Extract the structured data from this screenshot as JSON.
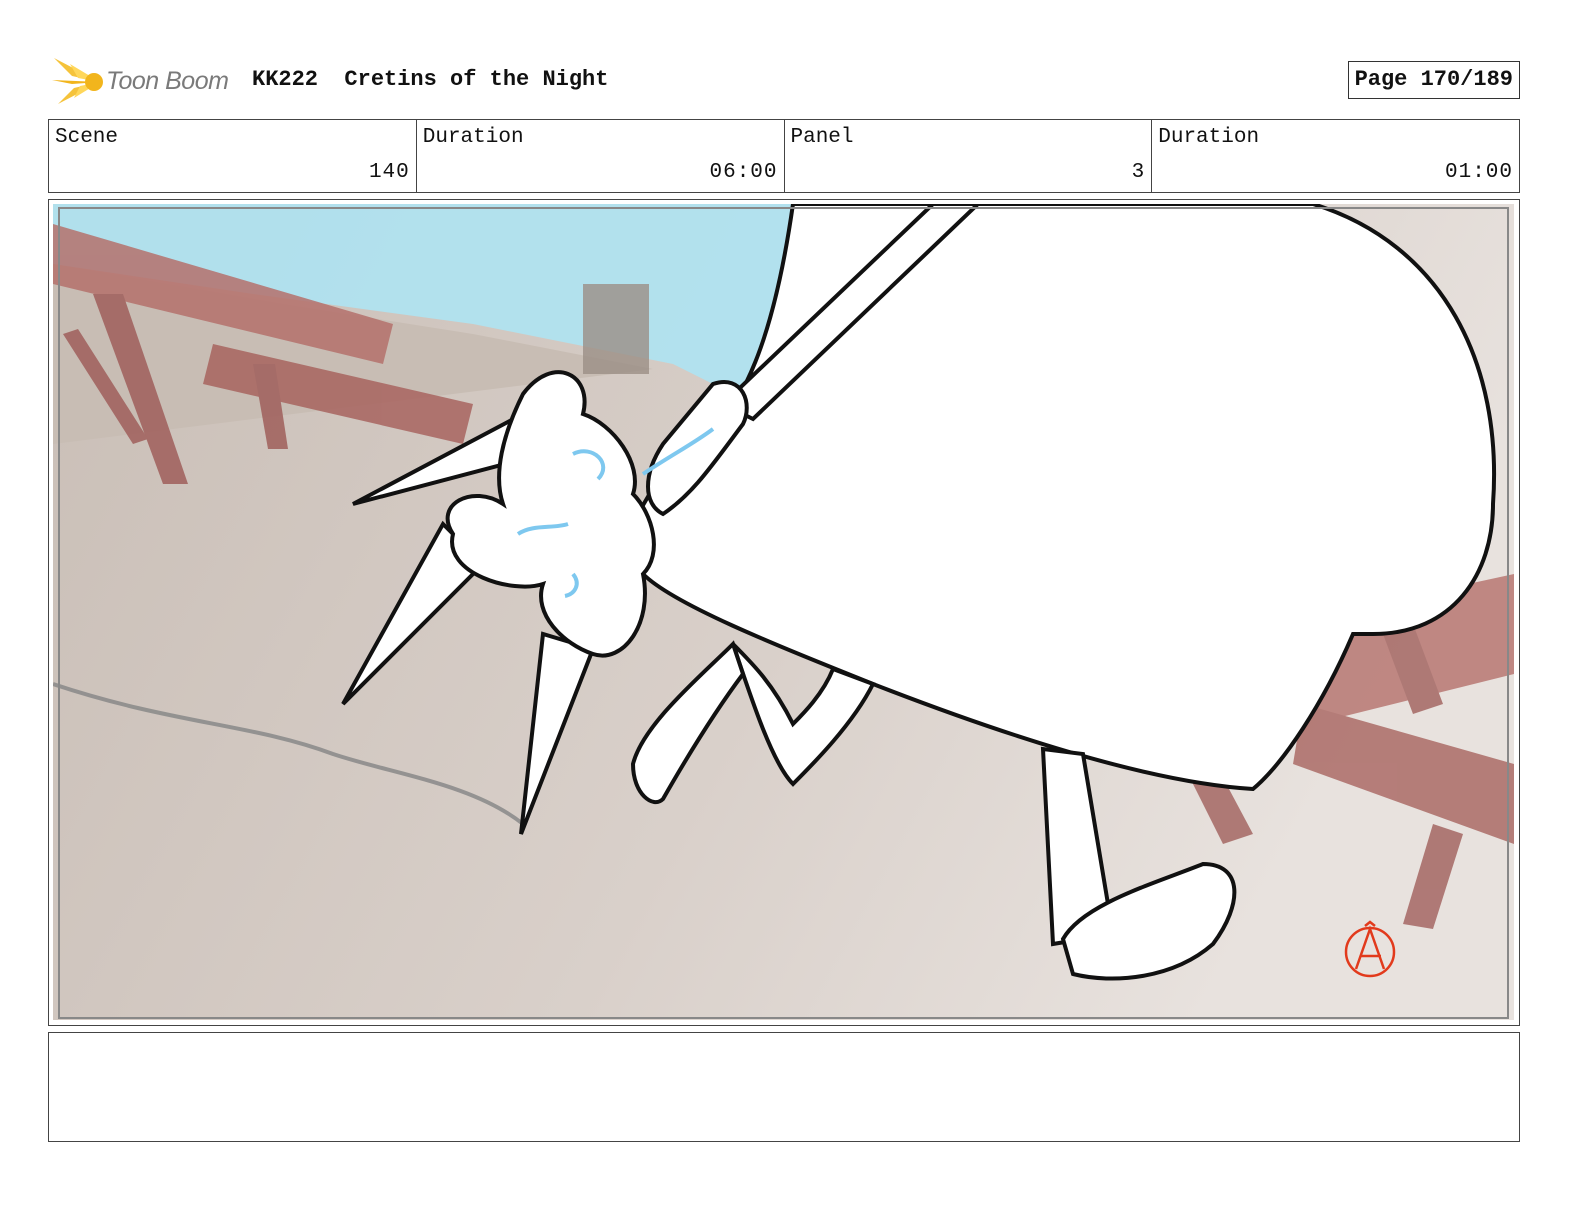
{
  "header": {
    "logo_text": "Toon Boom",
    "logo_icon": "toon-boom-burst-icon",
    "title": "KK222  Cretins of the Night",
    "page": "Page 170/189"
  },
  "info": {
    "scene_label": "Scene",
    "scene_value": "140",
    "scene_duration_label": "Duration",
    "scene_duration_value": "06:00",
    "panel_label": "Panel",
    "panel_value": "3",
    "panel_duration_label": "Duration",
    "panel_duration_value": "01:00"
  },
  "panel": {
    "artist_mark_icon": "circled-a-artist-mark-icon"
  },
  "notes": {
    "text": ""
  },
  "colors": {
    "logo_yellow": "#f2b51c",
    "water_blue": "#aee3f2",
    "table_red": "#b06f6b",
    "ground": "#d2c7bf",
    "effect_blue": "#7ec8ef",
    "artist_mark_red": "#e23a1c"
  }
}
